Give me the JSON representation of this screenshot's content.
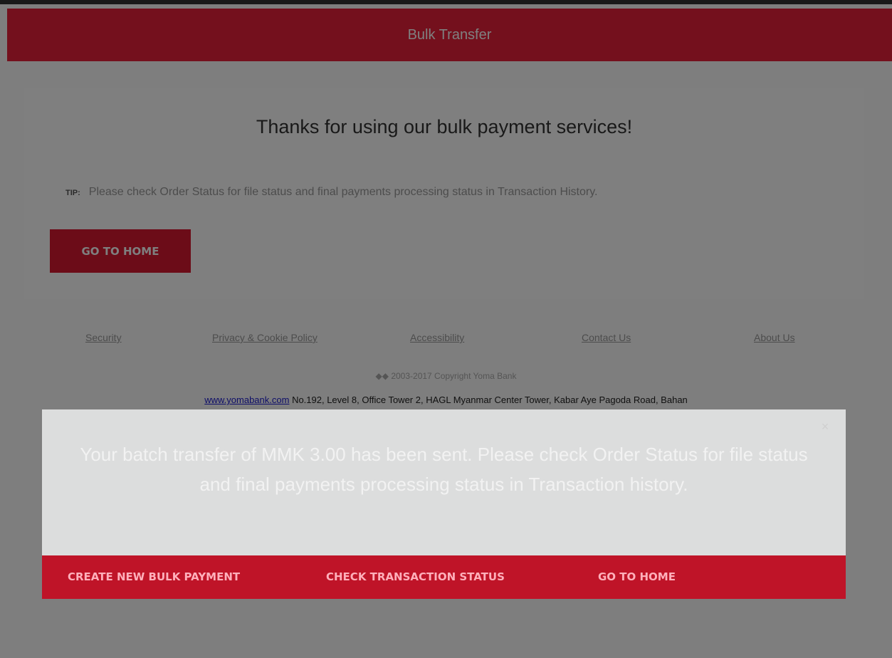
{
  "header": {
    "title": "Bulk Transfer"
  },
  "card": {
    "heading": "Thanks for using our bulk payment services!",
    "tip_label": "TIP:",
    "tip_text": "Please check Order Status for file status and final payments processing status in Transaction History.",
    "home_button_label": "GO TO HOME"
  },
  "footer": {
    "links": [
      "Security",
      "Privacy & Cookie Policy",
      "Accessibility",
      "Contact Us",
      "About Us"
    ],
    "copyright": "◆◆ 2003-2017 Copyright Yoma Bank",
    "website": "www.yomabank.com",
    "address": "No.192, Level 8, Office Tower 2, HAGL Myanmar Center Tower, Kabar Aye Pagoda Road, Bahan"
  },
  "modal": {
    "close_icon": "close-icon",
    "message": "Your batch transfer of MMK 3.00 has been sent. Please check Order Status for file status and final payments processing status in Transaction history.",
    "actions": [
      "CREATE NEW BULK PAYMENT",
      "CHECK TRANSACTION STATUS",
      "GO TO HOME"
    ]
  },
  "colors": {
    "brand_red": "#e8213a",
    "button_red": "#d81831",
    "modal_action_bar": "#bf1428",
    "modal_body": "#dcdddd"
  }
}
